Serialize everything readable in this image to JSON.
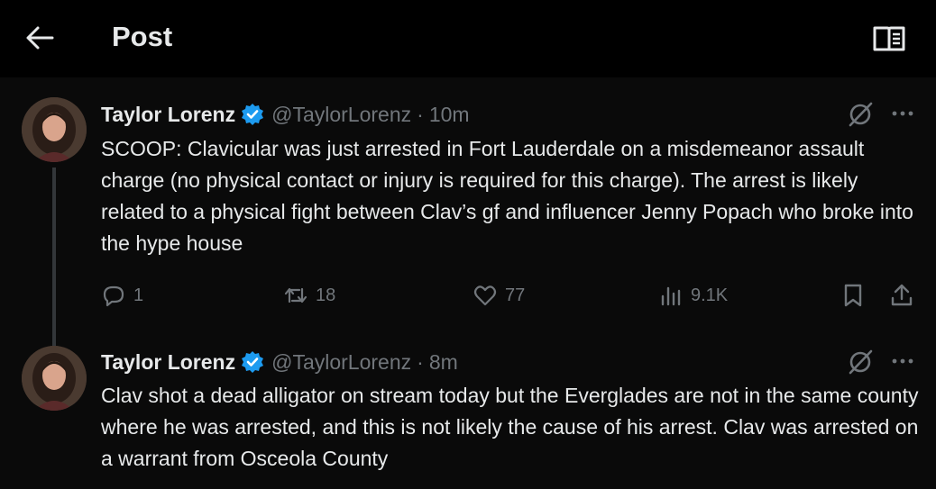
{
  "header": {
    "title": "Post",
    "back_icon": "arrow-left-icon",
    "reader_icon": "reader-mode-icon"
  },
  "colors": {
    "background": "#000000",
    "text": "#e7e9ea",
    "muted": "#71767b",
    "verified": "#1d9bf0",
    "thread_line": "#333639"
  },
  "tweets": [
    {
      "display_name": "Taylor Lorenz",
      "handle": "@TaylorLorenz",
      "separator": "·",
      "time": "10m",
      "verified": true,
      "text": "SCOOP: Clavicular was just arrested in Fort Lauderdale on a misdemeanor assault charge (no physical contact or injury is required for this charge). The arrest is likely related to a physical fight between Clav’s gf and influencer Jenny Popach who broke into the hype house",
      "stats": {
        "replies": "1",
        "reposts": "18",
        "likes": "77",
        "views": "9.1K"
      }
    },
    {
      "display_name": "Taylor Lorenz",
      "handle": "@TaylorLorenz",
      "separator": "·",
      "time": "8m",
      "verified": true,
      "text": "Clav shot a dead alligator on stream today but the Everglades are not in the same county where he was arrested, and this is not likely the cause of his arrest. Clav was arrested on a warrant from Osceola County"
    }
  ]
}
